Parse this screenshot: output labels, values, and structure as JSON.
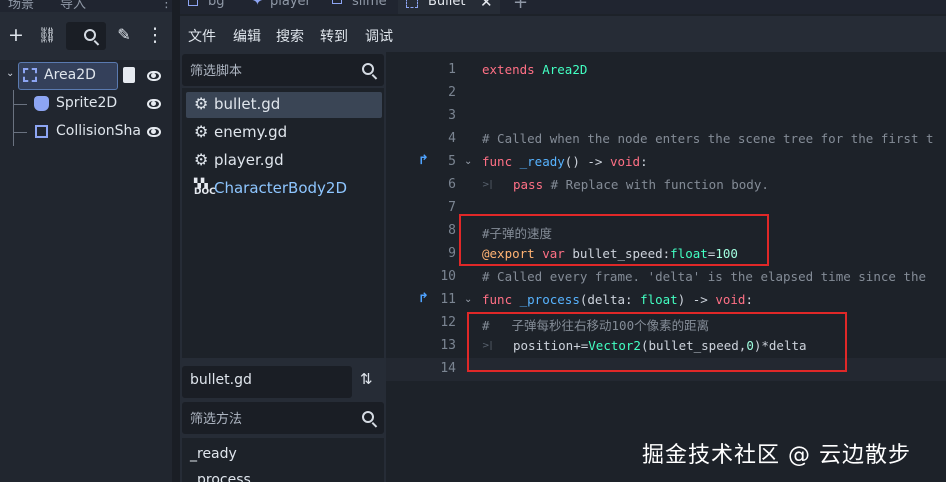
{
  "scene_dock": {
    "tabs": [
      "场景",
      "导入"
    ],
    "tree": [
      {
        "label": "Area2D",
        "icon": "area2d-icon",
        "selected": true
      },
      {
        "label": "Sprite2D",
        "icon": "sprite2d-icon",
        "selected": false
      },
      {
        "label": "CollisionSha",
        "icon": "collisionshape-icon",
        "selected": false
      }
    ]
  },
  "top_tabs": [
    "bg",
    "player",
    "slime",
    "Bullet"
  ],
  "menu": [
    "文件",
    "编辑",
    "搜索",
    "转到",
    "调试"
  ],
  "script_panel": {
    "filter_placeholder": "筛选脚本",
    "scripts": [
      "bullet.gd",
      "enemy.gd",
      "player.gd",
      "CharacterBody2D"
    ],
    "current_script": "bullet.gd",
    "method_filter_placeholder": "筛选方法",
    "methods": [
      "_ready",
      "_process"
    ]
  },
  "editor": {
    "line_numbers": [
      "1",
      "2",
      "3",
      "4",
      "5",
      "6",
      "7",
      "8",
      "9",
      "10",
      "11",
      "12",
      "13",
      "14"
    ],
    "lines": {
      "l1_kw": "extends",
      "l1_type": " Area2D",
      "l4": "# Called when the node enters the scene tree for the first t",
      "l5_kw": "func",
      "l5_fn": " _ready",
      "l5_rest": "() -> ",
      "l5_void": "void",
      "l5_end": ":",
      "l6_kw": "pass",
      "l6_cm": " # Replace with function body.",
      "l8": "#子弹的速度",
      "l9_an": "@export",
      "l9_kw": " var",
      "l9_name": " bullet_speed:",
      "l9_type": "float",
      "l9_eq": "=",
      "l9_num": "100",
      "l10": "# Called every frame. 'delta' is the elapsed time since the",
      "l11_kw": "func",
      "l11_fn": " _process",
      "l11_rest": "(delta: ",
      "l11_float": "float",
      "l11_rest2": ") -> ",
      "l11_void": "void",
      "l11_end": ":",
      "l12_hash": "#",
      "l12_cm": "子弹每秒往右移动100个像素的距离",
      "l13_a": "position+=",
      "l13_type": "Vector2",
      "l13_b": "(bullet_speed,",
      "l13_num": "0",
      "l13_c": ")*delta"
    }
  },
  "watermark": "掘金技术社区 @ 云边散步"
}
